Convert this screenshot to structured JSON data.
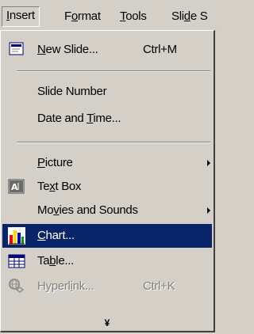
{
  "menubar": {
    "items": [
      {
        "label_prefix": "",
        "label_underline": "I",
        "label_rest": "nsert"
      },
      {
        "label_prefix": "F",
        "label_underline": "o",
        "label_rest": "rmat"
      },
      {
        "label_prefix": "",
        "label_underline": "T",
        "label_rest": "ools"
      },
      {
        "label_prefix": "Sli",
        "label_underline": "d",
        "label_rest": "e S"
      }
    ]
  },
  "menu": {
    "new_slide": {
      "label_underline": "N",
      "label_rest": "ew Slide...",
      "shortcut": "Ctrl+M"
    },
    "slide_number": {
      "label": "Slide Number"
    },
    "date_time": {
      "label_prefix": "Date and ",
      "label_underline": "T",
      "label_rest": "ime..."
    },
    "picture": {
      "label_underline": "P",
      "label_rest": "icture"
    },
    "text_box": {
      "label_prefix": "Te",
      "label_underline": "x",
      "label_rest": "t Box"
    },
    "movies_sounds": {
      "label_prefix": "Mo",
      "label_underline": "v",
      "label_rest": "ies and Sounds"
    },
    "chart": {
      "label_underline": "C",
      "label_rest": "hart..."
    },
    "table": {
      "label_prefix": "Ta",
      "label_underline": "b",
      "label_rest": "le..."
    },
    "hyperlink": {
      "label_prefix": "Hyperl",
      "label_underline": "i",
      "label_rest": "nk...",
      "shortcut": "Ctrl+K"
    },
    "expand_glyph": "¥"
  },
  "colors": {
    "highlight": "#0a246a",
    "menu_bg": "#d4d0c8",
    "disabled_text": "#808080"
  }
}
